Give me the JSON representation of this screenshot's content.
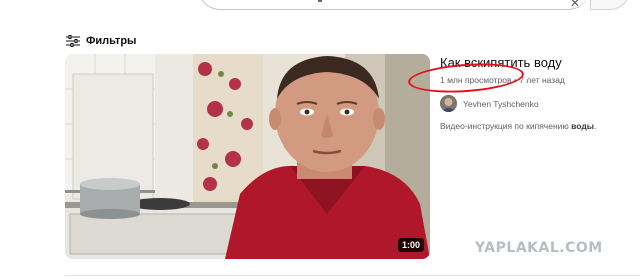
{
  "filters": {
    "label": "Фильтры",
    "icon": "filters-icon"
  },
  "video": {
    "title": "Как вскипятить воду",
    "views": "1 млн просмотров",
    "separator": " • ",
    "age": "7 лет назад",
    "duration": "1:00",
    "channel": "Yevhen Tyshchenko",
    "description_prefix": "Видео-инструкция по кипячению ",
    "description_bold": "воды",
    "description_suffix": "."
  },
  "annotation": {
    "color": "#e0141e"
  },
  "watermark": "YAPLAKAL.COM"
}
